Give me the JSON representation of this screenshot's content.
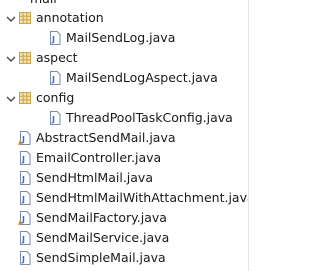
{
  "tree": {
    "partial_top_label": "mail",
    "items": [
      {
        "label": "annotation",
        "kind": "package",
        "expanded": true
      },
      {
        "label": "MailSendLog.java",
        "kind": "java-file"
      },
      {
        "label": "aspect",
        "kind": "package",
        "expanded": true
      },
      {
        "label": "MailSendLogAspect.java",
        "kind": "java-file"
      },
      {
        "label": "config",
        "kind": "package",
        "expanded": true
      },
      {
        "label": "ThreadPoolTaskConfig.java",
        "kind": "java-file"
      },
      {
        "label": "AbstractSendMail.java",
        "kind": "java-file-abstract"
      },
      {
        "label": "EmailController.java",
        "kind": "java-file"
      },
      {
        "label": "SendHtmlMail.java",
        "kind": "java-file"
      },
      {
        "label": "SendHtmlMailWithAttachment.java",
        "kind": "java-file"
      },
      {
        "label": "SendMailFactory.java",
        "kind": "java-file-abstract"
      },
      {
        "label": "SendMailService.java",
        "kind": "java-file"
      },
      {
        "label": "SendSimpleMail.java",
        "kind": "java-file"
      }
    ]
  },
  "colors": {
    "package_icon": "#c9a449",
    "java_file_icon": "#3b6cc4",
    "abstract_marker": "#d08a1a",
    "toggle": "#4a4a4a"
  },
  "icons": {
    "toggle": "chevron-down-icon",
    "package": "package-icon",
    "java_file": "java-file-icon"
  }
}
